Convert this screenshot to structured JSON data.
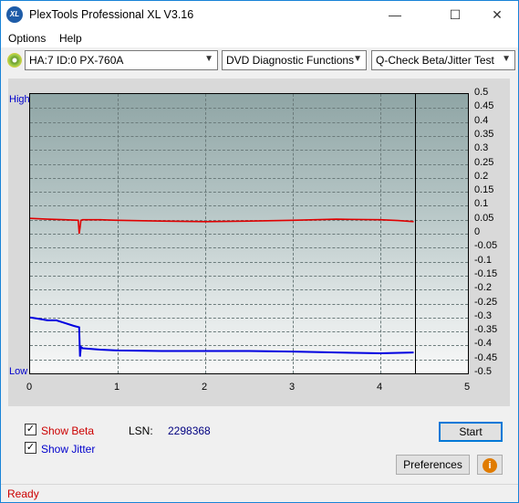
{
  "window": {
    "title": "PlexTools Professional XL V3.16",
    "icon_text": "XL",
    "minimize": "—",
    "maximize": "☐",
    "close": "✕"
  },
  "menu": {
    "options": "Options",
    "help": "Help"
  },
  "toolbar": {
    "drive": "HA:7 ID:0  PX-760A",
    "function": "DVD Diagnostic Functions",
    "test": "Q-Check Beta/Jitter Test"
  },
  "plot": {
    "high_label": "High",
    "low_label": "Low",
    "y_ticks": [
      "0.5",
      "0.45",
      "0.4",
      "0.35",
      "0.3",
      "0.25",
      "0.2",
      "0.15",
      "0.1",
      "0.05",
      "0",
      "-0.05",
      "-0.1",
      "-0.15",
      "-0.2",
      "-0.25",
      "-0.3",
      "-0.35",
      "-0.4",
      "-0.45",
      "-0.5"
    ],
    "x_ticks": [
      "0",
      "1",
      "2",
      "3",
      "4",
      "5"
    ]
  },
  "chart_data": {
    "type": "line",
    "xlim": [
      0,
      5
    ],
    "ylim": [
      -0.5,
      0.5
    ],
    "end_marker_x": 4.38,
    "grid": true,
    "series": [
      {
        "color": "#e00000",
        "x": [
          0,
          0.2,
          0.4,
          0.55,
          0.56,
          0.57,
          0.58,
          0.6,
          0.8,
          1.0,
          1.5,
          2.0,
          2.5,
          3.0,
          3.5,
          4.0,
          4.2,
          4.38
        ],
        "values": [
          0.055,
          0.052,
          0.05,
          0.048,
          0.0,
          0.02,
          0.048,
          0.05,
          0.05,
          0.048,
          0.045,
          0.043,
          0.045,
          0.048,
          0.052,
          0.05,
          0.047,
          0.043
        ]
      },
      {
        "color": "#0000e0",
        "x": [
          0,
          0.1,
          0.2,
          0.3,
          0.4,
          0.5,
          0.56,
          0.57,
          0.58,
          0.6,
          0.8,
          1.0,
          1.5,
          2.0,
          2.5,
          3.0,
          3.5,
          4.0,
          4.38
        ],
        "values": [
          -0.3,
          -0.305,
          -0.31,
          -0.31,
          -0.32,
          -0.33,
          -0.335,
          -0.44,
          -0.405,
          -0.41,
          -0.415,
          -0.418,
          -0.42,
          -0.42,
          -0.42,
          -0.422,
          -0.425,
          -0.428,
          -0.425
        ]
      }
    ]
  },
  "controls": {
    "show_beta": "Show Beta",
    "show_jitter": "Show Jitter",
    "beta_checked": "✓",
    "jitter_checked": "✓",
    "lsn_label": "LSN:",
    "lsn_value": "2298368",
    "start": "Start",
    "preferences": "Preferences",
    "info_icon": "i"
  },
  "status": {
    "text": "Ready"
  }
}
